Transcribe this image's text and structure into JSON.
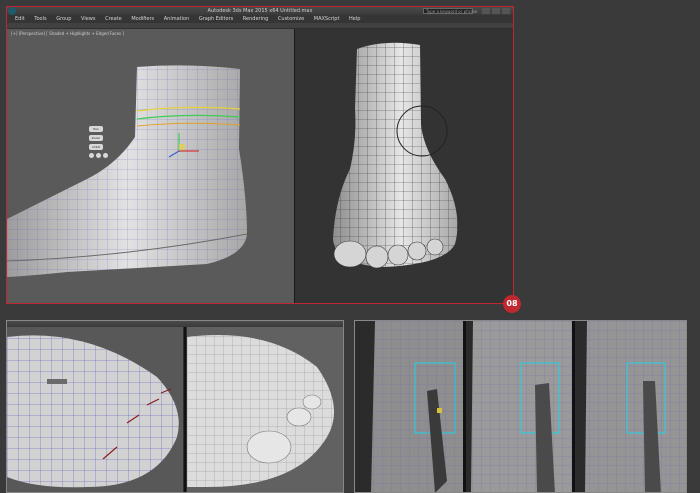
{
  "main_window": {
    "title": "Autodesk 3ds Max 2015 x64   Untitled.max",
    "menu": [
      "Edit",
      "Tools",
      "Group",
      "Views",
      "Create",
      "Modifiers",
      "Animation",
      "Graph Editors",
      "Rendering",
      "Customize",
      "MAXScript",
      "Help"
    ],
    "search_placeholder": "Type a keyword or phrase",
    "viewport_label": "[+] [Perspective] [ Shaded + Highlights + Edged Faces ]",
    "nav_buttons": [
      "Pan",
      "Zoom",
      "Orbit"
    ]
  },
  "badge": "08",
  "colors": {
    "accent_red": "#c0282f",
    "mesh_light": "#d9d9d9",
    "wire": "#4b4bd6",
    "selection": "#1fd1e6"
  }
}
